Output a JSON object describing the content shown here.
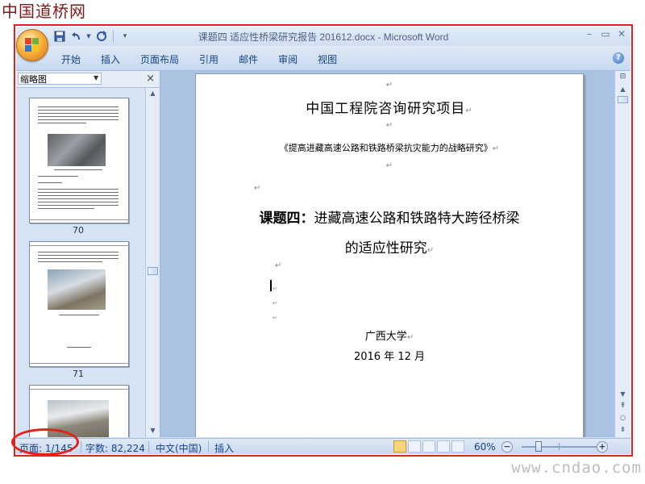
{
  "site": {
    "logo_text": "中国道桥网",
    "watermark": "www.cndao.com"
  },
  "window": {
    "title": "课题四 适应性桥梁研究报告 201612.docx - Microsoft Word"
  },
  "ribbon": {
    "tabs": [
      "开始",
      "插入",
      "页面布局",
      "引用",
      "邮件",
      "审阅",
      "视图"
    ]
  },
  "nav_pane": {
    "title": "缩略图",
    "thumbnails": [
      {
        "page_number": "70"
      },
      {
        "page_number": "71"
      },
      {
        "page_number": ""
      }
    ]
  },
  "document": {
    "heading": "中国工程院咨询研究项目",
    "subheading": "《提高进藏高速公路和铁路桥梁抗灾能力的战略研究》",
    "topic_label": "课题四：",
    "topic_line1": "进藏高速公路和铁路特大跨径桥梁",
    "topic_line2": "的适应性研究",
    "university": "广西大学",
    "date": "2016 年 12 月"
  },
  "status_bar": {
    "page_label": "页面:",
    "page_value": "1/145",
    "words_label": "字数:",
    "words_value": "82,224",
    "language": "中文(中国)",
    "mode": "插入",
    "zoom": "60%",
    "zoom_level": 0.6
  },
  "colors": {
    "highlight": "#e2231a",
    "ribbon_text": "#15428b",
    "doc_background": "#abc3e2"
  }
}
